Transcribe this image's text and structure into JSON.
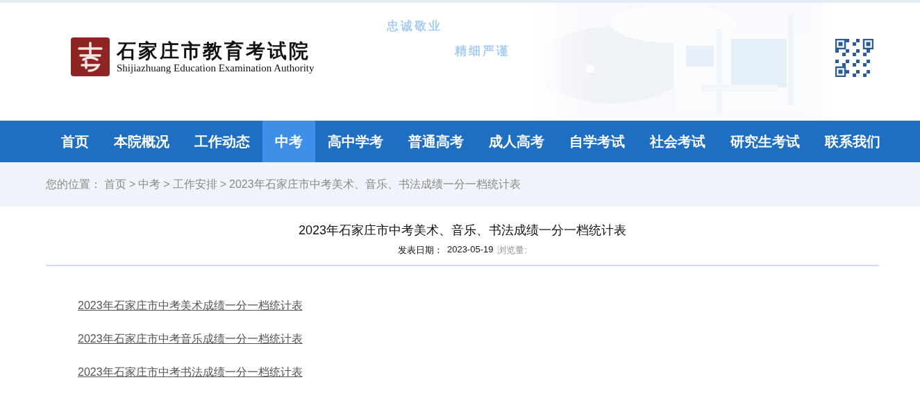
{
  "header": {
    "org_name": "石家庄市教育考试院",
    "org_name_en": "Shijiazhuang Education Examination Authority",
    "mottos": [
      "忠诚敬业",
      "精细严谨"
    ]
  },
  "nav": [
    {
      "label": "首页",
      "selected": false
    },
    {
      "label": "本院概况",
      "selected": false
    },
    {
      "label": "工作动态",
      "selected": false
    },
    {
      "label": "中考",
      "selected": true
    },
    {
      "label": "高中学考",
      "selected": false
    },
    {
      "label": "普通高考",
      "selected": false
    },
    {
      "label": "成人高考",
      "selected": false
    },
    {
      "label": "自学考试",
      "selected": false
    },
    {
      "label": "社会考试",
      "selected": false
    },
    {
      "label": "研究生考试",
      "selected": false
    },
    {
      "label": "联系我们",
      "selected": false
    }
  ],
  "breadcrumb": {
    "label": "您的位置：",
    "items": [
      {
        "text": "首页"
      },
      {
        "separator": ">",
        "text": "中考"
      },
      {
        "separator": ">",
        "text": "工作安排"
      },
      {
        "separator": ">",
        "text": "2023年石家庄市中考美术、音乐、书法成绩一分一档统计表"
      }
    ]
  },
  "article": {
    "title": "2023年石家庄市中考美术、音乐、书法成绩一分一档统计表",
    "date_label": "发表日期：",
    "date": "2023-05-19",
    "views_label": "浏览量:",
    "links": [
      "2023年石家庄市中考美术成绩一分一档统计表",
      "2023年石家庄市中考音乐成绩一分一档统计表",
      "2023年石家庄市中考书法成绩一分一档统计表"
    ]
  }
}
